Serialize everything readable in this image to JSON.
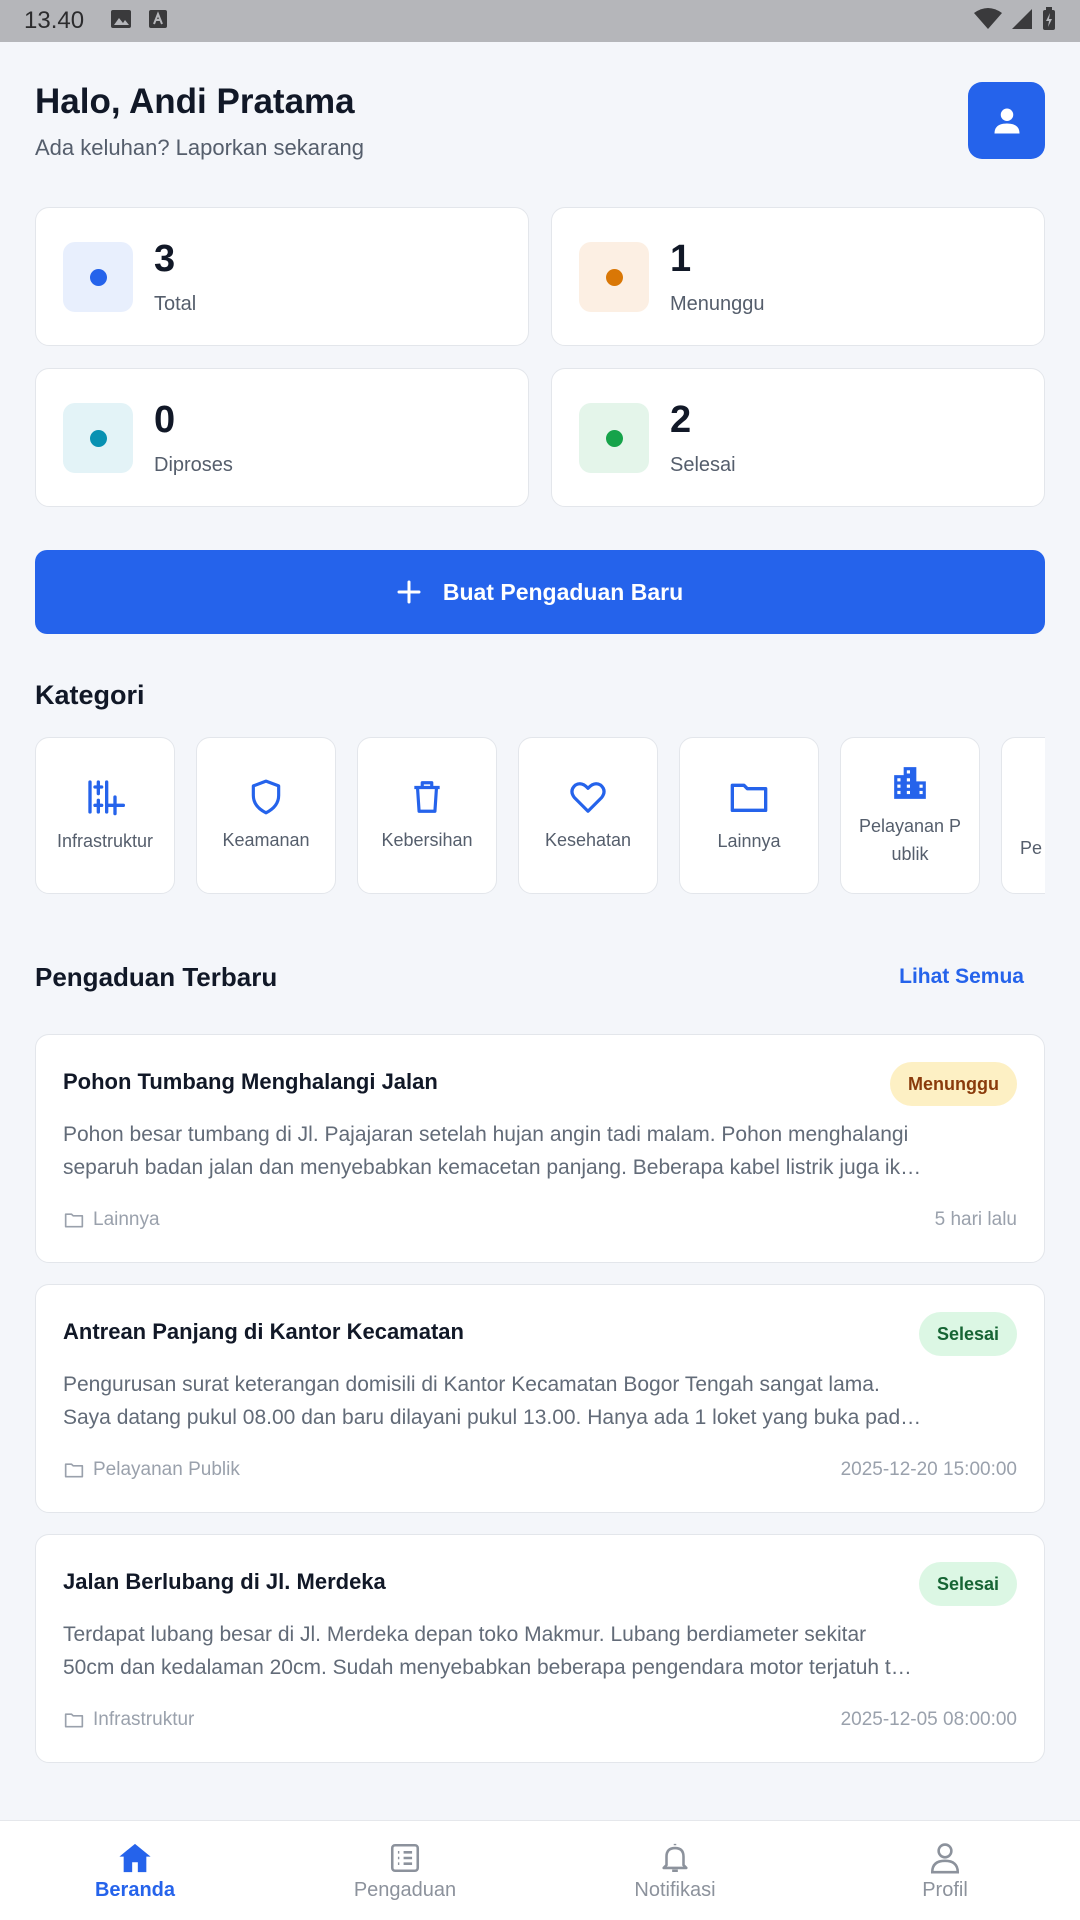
{
  "status_bar": {
    "time": "13.40"
  },
  "header": {
    "greeting": "Halo, Andi Pratama",
    "subtitle": "Ada keluhan? Laporkan sekarang"
  },
  "stats": [
    {
      "value": "3",
      "label": "Total",
      "color": "#2563eb",
      "bg": "#e8effd"
    },
    {
      "value": "1",
      "label": "Menunggu",
      "color": "#d97706",
      "bg": "#fcefe3"
    },
    {
      "value": "0",
      "label": "Diproses",
      "color": "#0891b2",
      "bg": "#e3f3f7"
    },
    {
      "value": "2",
      "label": "Selesai",
      "color": "#16a34a",
      "bg": "#e4f5ea"
    }
  ],
  "cta": {
    "label": "Buat Pengaduan Baru"
  },
  "categories": {
    "title": "Kategori",
    "items": [
      {
        "label": "Infrastruktur",
        "icon": "infrastructure-icon"
      },
      {
        "label": "Keamanan",
        "icon": "shield-icon"
      },
      {
        "label": "Kebersihan",
        "icon": "trash-icon"
      },
      {
        "label": "Kesehatan",
        "icon": "heart-icon"
      },
      {
        "label": "Lainnya",
        "icon": "folder-icon"
      },
      {
        "label": "Pelayanan Publik",
        "icon": "building-icon"
      },
      {
        "label": "Pe",
        "icon": "partial-icon"
      }
    ]
  },
  "recent": {
    "title": "Pengaduan Terbaru",
    "see_all": "Lihat Semua",
    "items": [
      {
        "title": "Pohon Tumbang Menghalangi Jalan",
        "status": "Menunggu",
        "status_color": "#8a3b0c",
        "status_bg": "#fdf0c4",
        "desc_line1": "Pohon besar tumbang di Jl. Pajajaran setelah hujan angin tadi malam. Pohon menghalangi",
        "desc_line2": "separuh badan jalan dan menyebabkan kemacetan panjang. Beberapa kabel listrik juga ik…",
        "category": "Lainnya",
        "date": "5 hari lalu"
      },
      {
        "title": "Antrean Panjang di Kantor Kecamatan",
        "status": "Selesai",
        "status_color": "#166534",
        "status_bg": "#dcf7e4",
        "desc_line1": "Pengurusan surat keterangan domisili di Kantor Kecamatan Bogor Tengah sangat lama.",
        "desc_line2": "Saya datang pukul 08.00 dan baru dilayani pukul 13.00. Hanya ada 1 loket yang buka pad…",
        "category": "Pelayanan Publik",
        "date": "2025-12-20 15:00:00"
      },
      {
        "title": "Jalan Berlubang di Jl. Merdeka",
        "status": "Selesai",
        "status_color": "#166534",
        "status_bg": "#dcf7e4",
        "desc_line1": "Terdapat lubang besar di Jl. Merdeka depan toko Makmur. Lubang berdiameter sekitar",
        "desc_line2": "50cm dan kedalaman 20cm. Sudah menyebabkan beberapa pengendara motor terjatuh t…",
        "category": "Infrastruktur",
        "date": "2025-12-05 08:00:00"
      }
    ]
  },
  "nav": {
    "active_color": "#2563eb",
    "inactive_color": "#8c929c",
    "items": [
      {
        "label": "Beranda",
        "icon": "home-icon"
      },
      {
        "label": "Pengaduan",
        "icon": "list-icon"
      },
      {
        "label": "Notifikasi",
        "icon": "bell-icon"
      },
      {
        "label": "Profil",
        "icon": "person-icon"
      }
    ]
  }
}
